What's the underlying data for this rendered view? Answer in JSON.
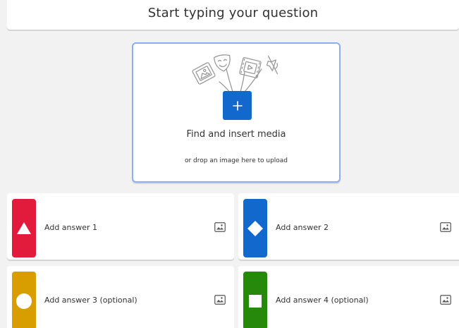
{
  "question": {
    "placeholder": "Start typing your question"
  },
  "media": {
    "title": "Find and insert media",
    "subtitle": "or drop an image here to upload",
    "button_icon": "plus-icon",
    "accent": "#1368ce"
  },
  "answers": [
    {
      "label": "Add answer 1",
      "shape": "triangle-icon",
      "color": "#e21b3c"
    },
    {
      "label": "Add answer 2",
      "shape": "diamond-icon",
      "color": "#1368ce"
    },
    {
      "label": "Add answer 3 (optional)",
      "shape": "circle-icon",
      "color": "#d89e00"
    },
    {
      "label": "Add answer 4 (optional)",
      "shape": "square-icon",
      "color": "#26890c"
    }
  ]
}
